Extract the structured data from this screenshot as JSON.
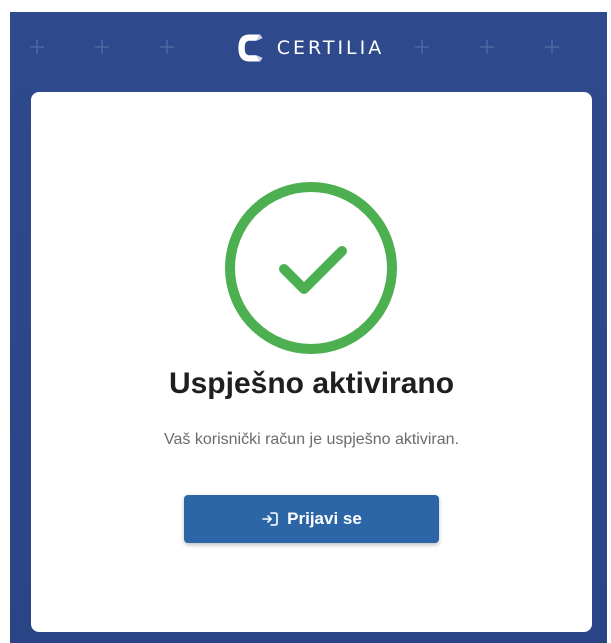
{
  "brand": {
    "name": "CERTILIA",
    "logo_icon": "certilia-logo-icon"
  },
  "status": {
    "icon": "check-circle-icon",
    "title": "Uspješno aktivirano",
    "message": "Vaš korisnički račun je uspješno aktiviran."
  },
  "actions": {
    "login_icon": "login-icon",
    "login_label": "Prijavi se"
  },
  "colors": {
    "background": "#2e4a8d",
    "success": "#4caf50",
    "button": "#2c66a6",
    "title": "#1f1f1f",
    "subtitle": "#6b6b6b"
  }
}
